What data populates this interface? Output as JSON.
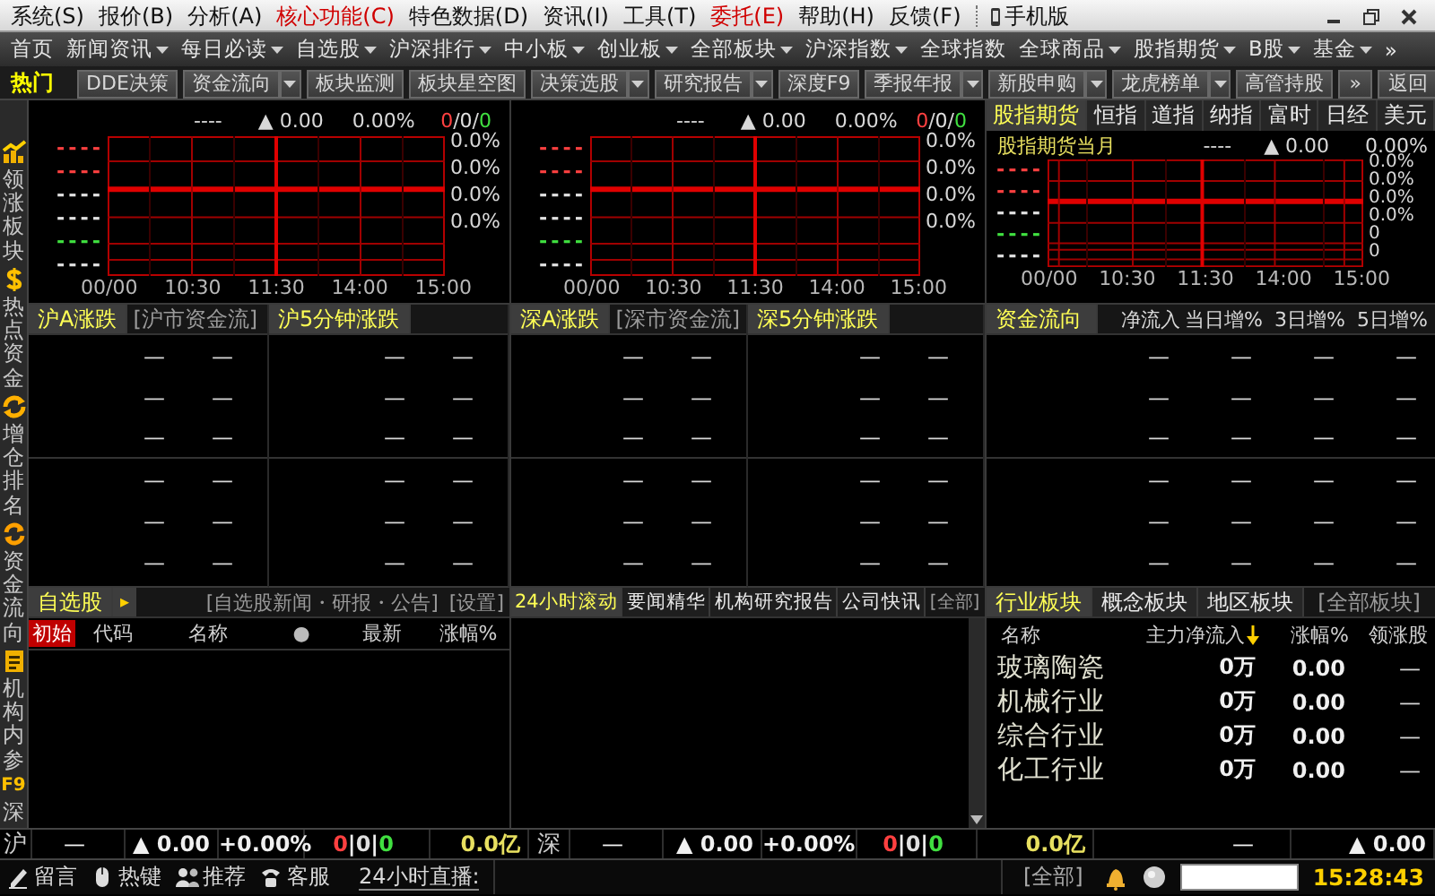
{
  "menu_bar": {
    "items": [
      {
        "label": "系统(S)",
        "highlight": false
      },
      {
        "label": "报价(B)",
        "highlight": false
      },
      {
        "label": "分析(A)",
        "highlight": false
      },
      {
        "label": "核心功能(C)",
        "highlight": true
      },
      {
        "label": "特色数据(D)",
        "highlight": false
      },
      {
        "label": "资讯(I)",
        "highlight": false
      },
      {
        "label": "工具(T)",
        "highlight": false
      },
      {
        "label": "委托(E)",
        "highlight": true
      },
      {
        "label": "帮助(H)",
        "highlight": false
      },
      {
        "label": "反馈(F)",
        "highlight": false
      }
    ],
    "mobile": "手机版"
  },
  "nav_bar": {
    "items": [
      {
        "label": "首页",
        "dropdown": false
      },
      {
        "label": "新闻资讯",
        "dropdown": true
      },
      {
        "label": "每日必读",
        "dropdown": true
      },
      {
        "label": "自选股",
        "dropdown": true
      },
      {
        "label": "沪深排行",
        "dropdown": true
      },
      {
        "label": "中小板",
        "dropdown": true
      },
      {
        "label": "创业板",
        "dropdown": true
      },
      {
        "label": "全部板块",
        "dropdown": true
      },
      {
        "label": "沪深指数",
        "dropdown": true
      },
      {
        "label": "全球指数",
        "dropdown": false
      },
      {
        "label": "全球商品",
        "dropdown": true
      },
      {
        "label": "股指期货",
        "dropdown": true
      },
      {
        "label": "B股",
        "dropdown": true
      },
      {
        "label": "基金",
        "dropdown": true
      }
    ],
    "more": "»"
  },
  "hot_bar": {
    "title": "热门",
    "buttons": [
      {
        "label": "DDE决策",
        "dropdown": false
      },
      {
        "label": "资金流向",
        "dropdown": true
      },
      {
        "label": "板块监测",
        "dropdown": false
      },
      {
        "label": "板块星空图",
        "dropdown": false
      },
      {
        "label": "决策选股",
        "dropdown": true
      },
      {
        "label": "研究报告",
        "dropdown": true
      },
      {
        "label": "深度F9",
        "dropdown": false
      },
      {
        "label": "季报年报",
        "dropdown": true
      },
      {
        "label": "新股申购",
        "dropdown": true
      },
      {
        "label": "龙虎榜单",
        "dropdown": true
      },
      {
        "label": "高管持股",
        "dropdown": false
      }
    ],
    "more": "»",
    "back": "返回"
  },
  "sidebar": {
    "items": [
      {
        "kind": "chart",
        "label": "领涨板块"
      },
      {
        "kind": "coin",
        "label": "热点资金"
      },
      {
        "kind": "exchange",
        "label": "增仓排名"
      },
      {
        "kind": "refresh",
        "label": "资金流向"
      },
      {
        "kind": "document",
        "label": "机构内参"
      },
      {
        "kind": "key",
        "badge": "F9",
        "label": "深"
      }
    ]
  },
  "index_charts": [
    {
      "volume": "----",
      "change": "▲ 0.00",
      "percent": "0.00%",
      "counts": [
        "0",
        "0",
        "0"
      ],
      "separator": "/",
      "left_labels": [
        {
          "text": "----",
          "color": "#ff4040"
        },
        {
          "text": "----",
          "color": "#ff4040"
        },
        {
          "text": "----",
          "color": "#e0e0e0"
        },
        {
          "text": "----",
          "color": "#e0e0e0"
        },
        {
          "text": "----",
          "color": "#40e040"
        },
        {
          "text": "----",
          "color": "#e0e0e0"
        }
      ],
      "right_labels": [
        "0.0%",
        "0.0%",
        "0.0%",
        "0.0%"
      ],
      "x_labels": [
        "00/00",
        "10:30",
        "11:30",
        "14:00",
        "15:00"
      ]
    },
    {
      "volume": "----",
      "change": "▲ 0.00",
      "percent": "0.00%",
      "counts": [
        "0",
        "0",
        "0"
      ],
      "separator": "/",
      "left_labels": [
        {
          "text": "----",
          "color": "#ff4040"
        },
        {
          "text": "----",
          "color": "#ff4040"
        },
        {
          "text": "----",
          "color": "#e0e0e0"
        },
        {
          "text": "----",
          "color": "#e0e0e0"
        },
        {
          "text": "----",
          "color": "#40e040"
        },
        {
          "text": "----",
          "color": "#e0e0e0"
        }
      ],
      "right_labels": [
        "0.0%",
        "0.0%",
        "0.0%",
        "0.0%"
      ],
      "x_labels": [
        "00/00",
        "10:30",
        "11:30",
        "14:00",
        "15:00"
      ]
    }
  ],
  "futures_panel": {
    "tabs": [
      {
        "label": "股指期货",
        "selected": true
      },
      {
        "label": "恒指",
        "selected": false
      },
      {
        "label": "道指",
        "selected": false
      },
      {
        "label": "纳指",
        "selected": false
      },
      {
        "label": "富时",
        "selected": false
      },
      {
        "label": "日经",
        "selected": false
      },
      {
        "label": "美元",
        "selected": false
      }
    ],
    "title": "股指期货当月",
    "volume": "----",
    "change": "▲ 0.00",
    "percent": "0.00%",
    "left_labels": [
      {
        "text": "----",
        "color": "#ff4040"
      },
      {
        "text": "----",
        "color": "#ff4040"
      },
      {
        "text": "----",
        "color": "#e0e0e0"
      },
      {
        "text": "----",
        "color": "#40e040"
      },
      {
        "text": "----",
        "color": "#e0e0e0"
      }
    ],
    "right_labels": [
      "0.0%",
      "0.0%",
      "0.0%",
      "0.0%",
      "0",
      "0"
    ],
    "x_labels": [
      "00/00",
      "10:30",
      "11:30",
      "14:00",
      "15:00"
    ]
  },
  "rank_panels": [
    {
      "title": "沪A涨跌",
      "link": "[沪市资金流]",
      "rows": [
        [
          "—",
          "—"
        ],
        [
          "—",
          "—"
        ],
        [
          "—",
          "—"
        ],
        [
          "—",
          "—"
        ],
        [
          "—",
          "—"
        ],
        [
          "—",
          "—"
        ]
      ]
    },
    {
      "title": "沪5分钟涨跌",
      "rows": [
        [
          "—",
          "—"
        ],
        [
          "—",
          "—"
        ],
        [
          "—",
          "—"
        ],
        [
          "—",
          "—"
        ],
        [
          "—",
          "—"
        ],
        [
          "—",
          "—"
        ]
      ]
    },
    {
      "title": "深A涨跌",
      "link": "[深市资金流]",
      "rows": [
        [
          "—",
          "—"
        ],
        [
          "—",
          "—"
        ],
        [
          "—",
          "—"
        ],
        [
          "—",
          "—"
        ],
        [
          "—",
          "—"
        ],
        [
          "—",
          "—"
        ]
      ]
    },
    {
      "title": "深5分钟涨跌",
      "rows": [
        [
          "—",
          "—"
        ],
        [
          "—",
          "—"
        ],
        [
          "—",
          "—"
        ],
        [
          "—",
          "—"
        ],
        [
          "—",
          "—"
        ],
        [
          "—",
          "—"
        ]
      ]
    }
  ],
  "flow_panel": {
    "title": "资金流向",
    "columns": [
      "净流入",
      "当日增%",
      "3日增%",
      "5日增%"
    ],
    "rows": [
      [
        "—",
        "—",
        "—",
        "—"
      ],
      [
        "—",
        "—",
        "—",
        "—"
      ],
      [
        "—",
        "—",
        "—",
        "—"
      ],
      [
        "—",
        "—",
        "—",
        "—"
      ],
      [
        "—",
        "—",
        "—",
        "—"
      ],
      [
        "—",
        "—",
        "—",
        "—"
      ]
    ]
  },
  "watchlist": {
    "tab": "自选股",
    "arrow": "▸",
    "links": [
      "[自选股新闻・研报・公告]",
      "[设置]"
    ],
    "columns": [
      {
        "label": "初始",
        "selected": true
      },
      {
        "label": "代码",
        "selected": false
      },
      {
        "label": "名称",
        "selected": false
      },
      {
        "label": "●",
        "selected": false
      },
      {
        "label": "最新",
        "selected": false
      },
      {
        "label": "涨幅%",
        "selected": false
      }
    ]
  },
  "news_panel": {
    "tabs": [
      {
        "label": "24小时滚动",
        "selected": true
      },
      {
        "label": "要闻精华",
        "selected": false
      },
      {
        "label": "机构研究报告",
        "selected": false
      },
      {
        "label": "公司快讯",
        "selected": false
      }
    ],
    "all_link": "[全部]"
  },
  "sector_panel": {
    "tabs": [
      {
        "label": "行业板块",
        "selected": true
      },
      {
        "label": "概念板块",
        "selected": false
      },
      {
        "label": "地区板块",
        "selected": false
      }
    ],
    "all_link": "[全部板块]",
    "columns": [
      {
        "label": "名称"
      },
      {
        "label": "主力净流入",
        "sorted": true
      },
      {
        "label": "涨幅%"
      },
      {
        "label": "领涨股"
      }
    ],
    "rows": [
      {
        "name": "玻璃陶瓷",
        "inflow": "0万",
        "change": "0.00",
        "leader": "—"
      },
      {
        "name": "机械行业",
        "inflow": "0万",
        "change": "0.00",
        "leader": "—"
      },
      {
        "name": "综合行业",
        "inflow": "0万",
        "change": "0.00",
        "leader": "—"
      },
      {
        "name": "化工行业",
        "inflow": "0万",
        "change": "0.00",
        "leader": "—"
      }
    ]
  },
  "ticker": {
    "markets": [
      {
        "label": "沪",
        "value": "—",
        "change": "▲ 0.00",
        "percent": "+0.00%",
        "counts": [
          "0",
          "0",
          "0"
        ],
        "amount": "0.0亿"
      },
      {
        "label": "深",
        "value": "—",
        "change": "▲ 0.00",
        "percent": "+0.00%",
        "counts": [
          "0",
          "0",
          "0"
        ],
        "amount": "0.0亿"
      }
    ],
    "separator": "|",
    "extra": {
      "value": "—",
      "change": "▲ 0.00"
    }
  },
  "status_bar": {
    "items": [
      {
        "kind": "pencil",
        "label": "留言"
      },
      {
        "kind": "mouse",
        "label": "热键"
      },
      {
        "kind": "people",
        "label": "推荐"
      },
      {
        "kind": "phone",
        "label": "客服"
      }
    ],
    "live": "24小时直播:",
    "all_link": "[全部]",
    "time": "15:28:43"
  }
}
